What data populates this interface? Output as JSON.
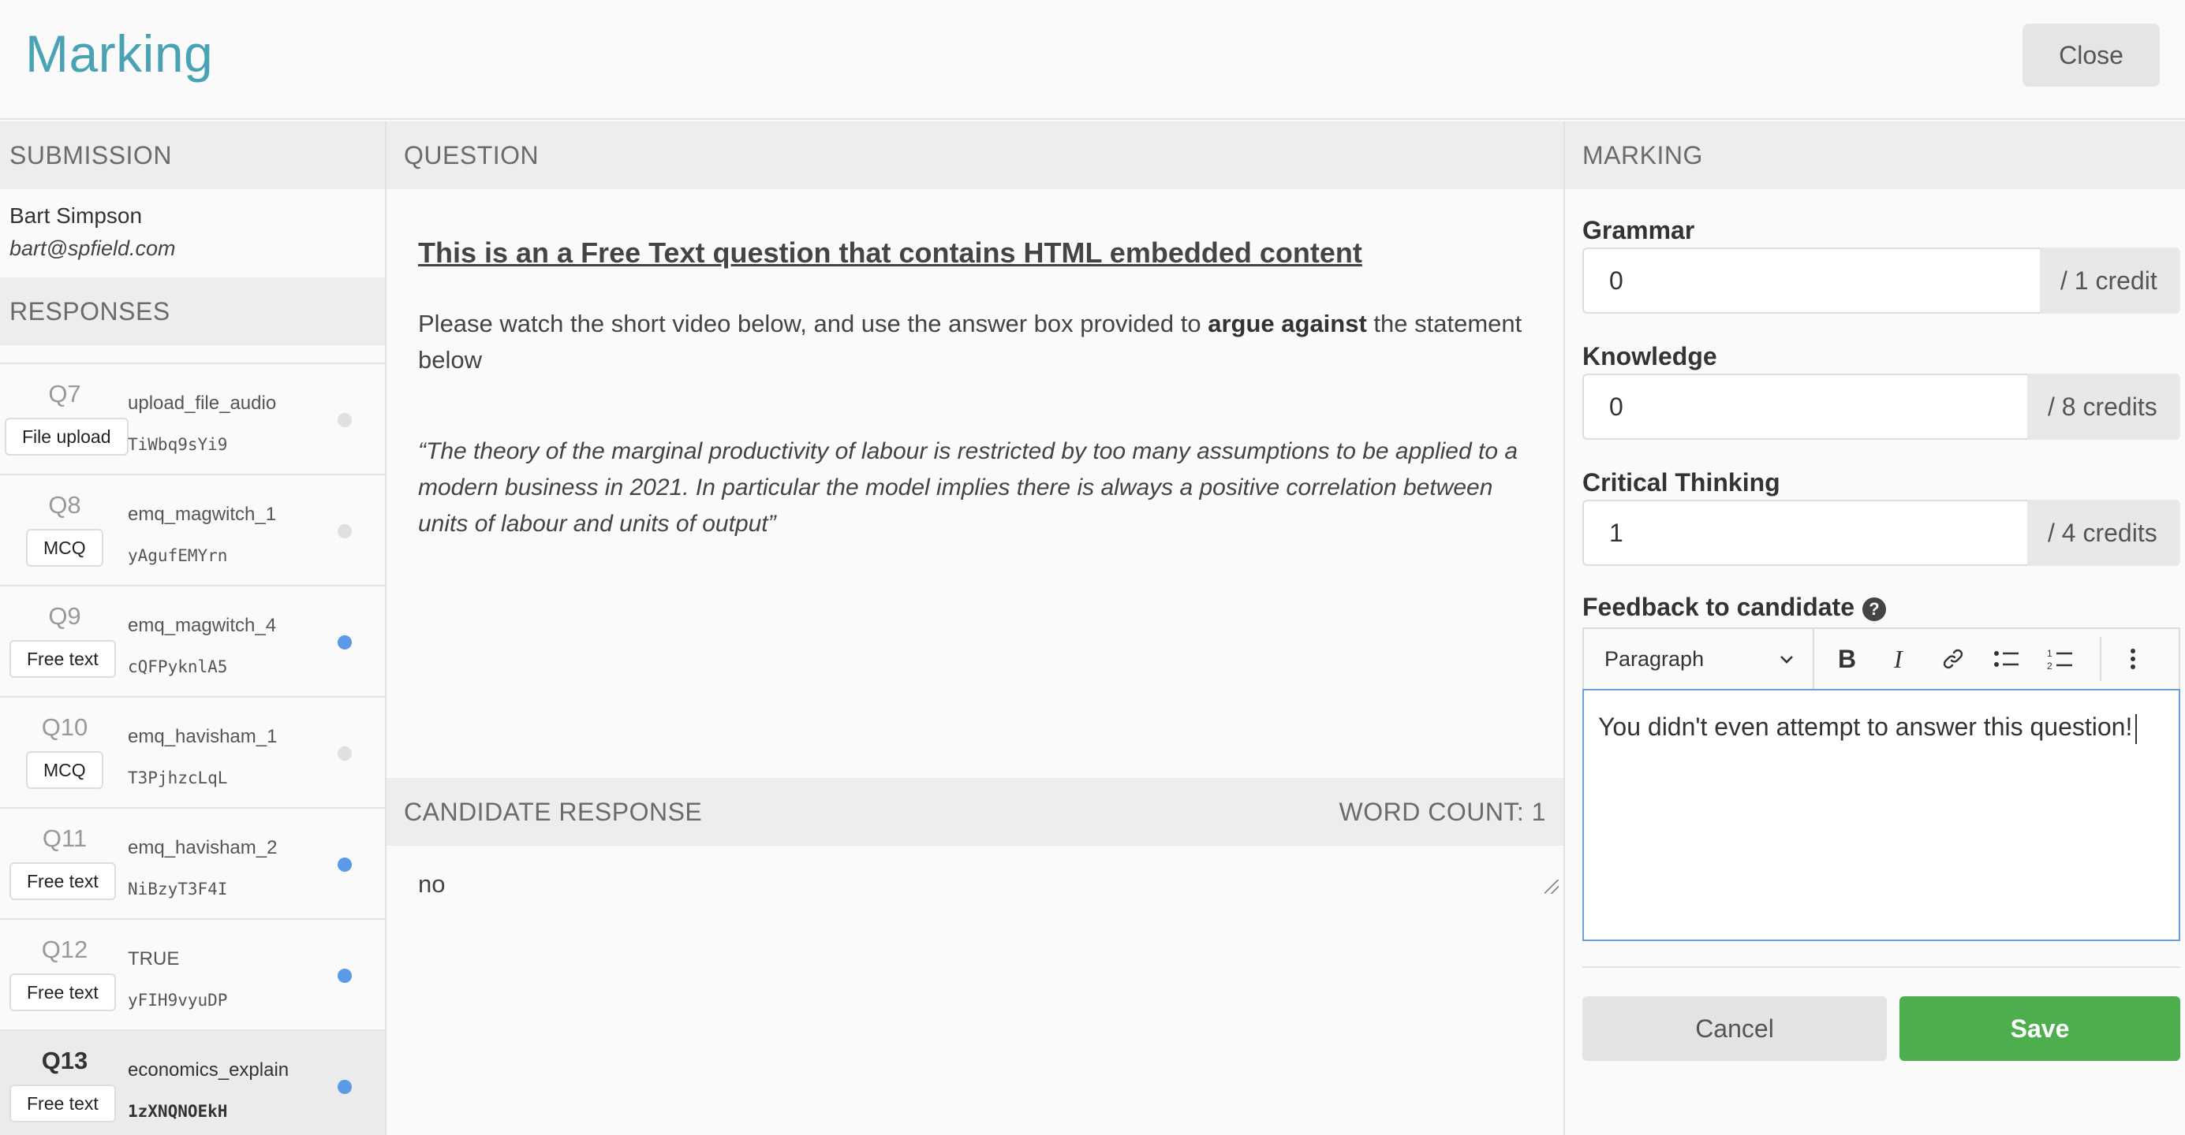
{
  "header": {
    "title": "Marking",
    "close_label": "Close"
  },
  "submission": {
    "header": "SUBMISSION",
    "candidate_name": "Bart Simpson",
    "candidate_email": "bart@spfield.com",
    "responses_header": "RESPONSES"
  },
  "responses": [
    {
      "q": "Q7",
      "type": "File upload",
      "name": "upload_file_audio",
      "code": "TiWbq9sYi9",
      "marked": false,
      "active": false
    },
    {
      "q": "Q8",
      "type": "MCQ",
      "name": "emq_magwitch_1",
      "code": "yAgufEMYrn",
      "marked": false,
      "active": false
    },
    {
      "q": "Q9",
      "type": "Free text",
      "name": "emq_magwitch_4",
      "code": "cQFPyknlA5",
      "marked": true,
      "active": false
    },
    {
      "q": "Q10",
      "type": "MCQ",
      "name": "emq_havisham_1",
      "code": "T3PjhzcLqL",
      "marked": false,
      "active": false
    },
    {
      "q": "Q11",
      "type": "Free text",
      "name": "emq_havisham_2",
      "code": "NiBzyT3F4I",
      "marked": true,
      "active": false
    },
    {
      "q": "Q12",
      "type": "Free text",
      "name": "TRUE",
      "code": "yFIH9vyuDP",
      "marked": true,
      "active": false
    },
    {
      "q": "Q13",
      "type": "Free text",
      "name": "economics_explain",
      "code": "1zXNQNOEkH",
      "marked": true,
      "active": true
    }
  ],
  "question": {
    "header": "QUESTION",
    "title": "This is an a Free Text question that contains  HTML embedded content ",
    "text_before": "Please watch the short video below, and use the answer box provided to ",
    "text_bold": "argue against",
    "text_after": " the statement below",
    "quote": "“The theory of the marginal productivity of labour is restricted by too many assumptions to be applied to a modern business in 2021. In particular the model implies there is always a positive correlation between units of labour and units of output”"
  },
  "candidate_response": {
    "header": "CANDIDATE RESPONSE",
    "word_count": "WORD COUNT: 1",
    "text": "no"
  },
  "marking": {
    "header": "MARKING",
    "criteria": [
      {
        "label": "Grammar",
        "value": "0",
        "suffix": "/ 1 credit"
      },
      {
        "label": "Knowledge",
        "value": "0",
        "suffix": "/ 8 credits"
      },
      {
        "label": "Critical Thinking",
        "value": "1",
        "suffix": "/ 4 credits"
      }
    ],
    "feedback_label": "Feedback to candidate",
    "help_glyph": "?",
    "paragraph_select": "Paragraph",
    "feedback_text": "You didn't even attempt to answer this question!",
    "cancel_label": "Cancel",
    "save_label": "Save"
  },
  "colors": {
    "accent": "#4aa3b5",
    "save": "#4cae4c",
    "dot_on": "#5a9ae6",
    "dot_off": "#e0e0e0"
  }
}
